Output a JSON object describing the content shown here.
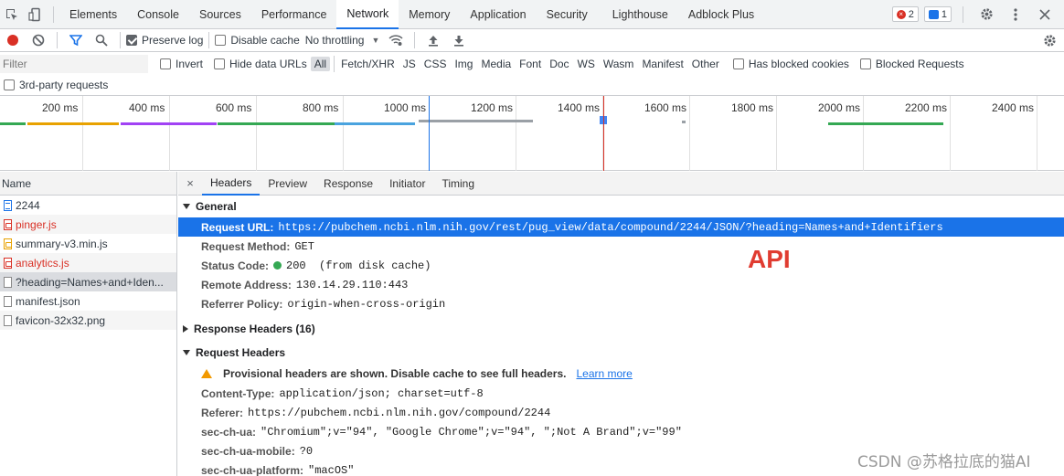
{
  "tabs": [
    "Elements",
    "Console",
    "Sources",
    "Performance",
    "Network",
    "Memory",
    "Application",
    "Security",
    "Lighthouse",
    "Adblock Plus"
  ],
  "active_tab": "Network",
  "badges": {
    "errors": "2",
    "messages": "1"
  },
  "toolbar": {
    "preserve_log": "Preserve log",
    "disable_cache": "Disable cache",
    "throttling": "No throttling"
  },
  "filter": {
    "placeholder": "Filter",
    "invert": "Invert",
    "hide_data_urls": "Hide data URLs",
    "types": [
      "All",
      "Fetch/XHR",
      "JS",
      "CSS",
      "Img",
      "Media",
      "Font",
      "Doc",
      "WS",
      "Wasm",
      "Manifest",
      "Other"
    ],
    "has_blocked_cookies": "Has blocked cookies",
    "blocked_requests": "Blocked Requests",
    "third_party": "3rd-party requests"
  },
  "timeline": {
    "ticks": [
      "200 ms",
      "400 ms",
      "600 ms",
      "800 ms",
      "1000 ms",
      "1200 ms",
      "1400 ms",
      "1600 ms",
      "1800 ms",
      "2000 ms",
      "2200 ms",
      "2400 ms"
    ]
  },
  "requests": {
    "header": "Name",
    "items": [
      {
        "name": "2244",
        "icon": "doc",
        "red": false
      },
      {
        "name": "pinger.js",
        "icon": "js",
        "red": true
      },
      {
        "name": "summary-v3.min.js",
        "icon": "js-ok",
        "red": false
      },
      {
        "name": "analytics.js",
        "icon": "js",
        "red": true
      },
      {
        "name": "?heading=Names+and+Iden...",
        "icon": "blank",
        "red": false
      },
      {
        "name": "manifest.json",
        "icon": "blank",
        "red": false
      },
      {
        "name": "favicon-32x32.png",
        "icon": "blank",
        "red": false
      }
    ]
  },
  "detail": {
    "close": "×",
    "tabs": [
      "Headers",
      "Preview",
      "Response",
      "Initiator",
      "Timing"
    ],
    "active_tab": "Headers",
    "general": {
      "title": "General",
      "request_url_k": "Request URL:",
      "request_url_v": "https://pubchem.ncbi.nlm.nih.gov/rest/pug_view/data/compound/2244/JSON/?heading=Names+and+Identifiers",
      "method_k": "Request Method:",
      "method_v": "GET",
      "status_k": "Status Code:",
      "status_v": "200  (from disk cache)",
      "remote_k": "Remote Address:",
      "remote_v": "130.14.29.110:443",
      "referrer_policy_k": "Referrer Policy:",
      "referrer_policy_v": "origin-when-cross-origin"
    },
    "response_headers": "Response Headers (16)",
    "request_headers": {
      "title": "Request Headers",
      "warning": "Provisional headers are shown. Disable cache to see full headers.",
      "learn_more": "Learn more",
      "content_type_k": "Content-Type:",
      "content_type_v": "application/json; charset=utf-8",
      "referer_k": "Referer:",
      "referer_v": "https://pubchem.ncbi.nlm.nih.gov/compound/2244",
      "sec_ch_ua_k": "sec-ch-ua:",
      "sec_ch_ua_v": "\"Chromium\";v=\"94\", \"Google Chrome\";v=\"94\", \";Not A Brand\";v=\"99\"",
      "mobile_k": "sec-ch-ua-mobile:",
      "mobile_v": "?0",
      "platform_k": "sec-ch-ua-platform:",
      "platform_v": "\"macOS\""
    }
  },
  "annotation": "API",
  "watermark": "CSDN @苏格拉底的猫AI",
  "colors": {
    "accent": "#1a73e8",
    "error": "#d93025",
    "annotation": "#e03c31",
    "ok": "#34a853"
  }
}
